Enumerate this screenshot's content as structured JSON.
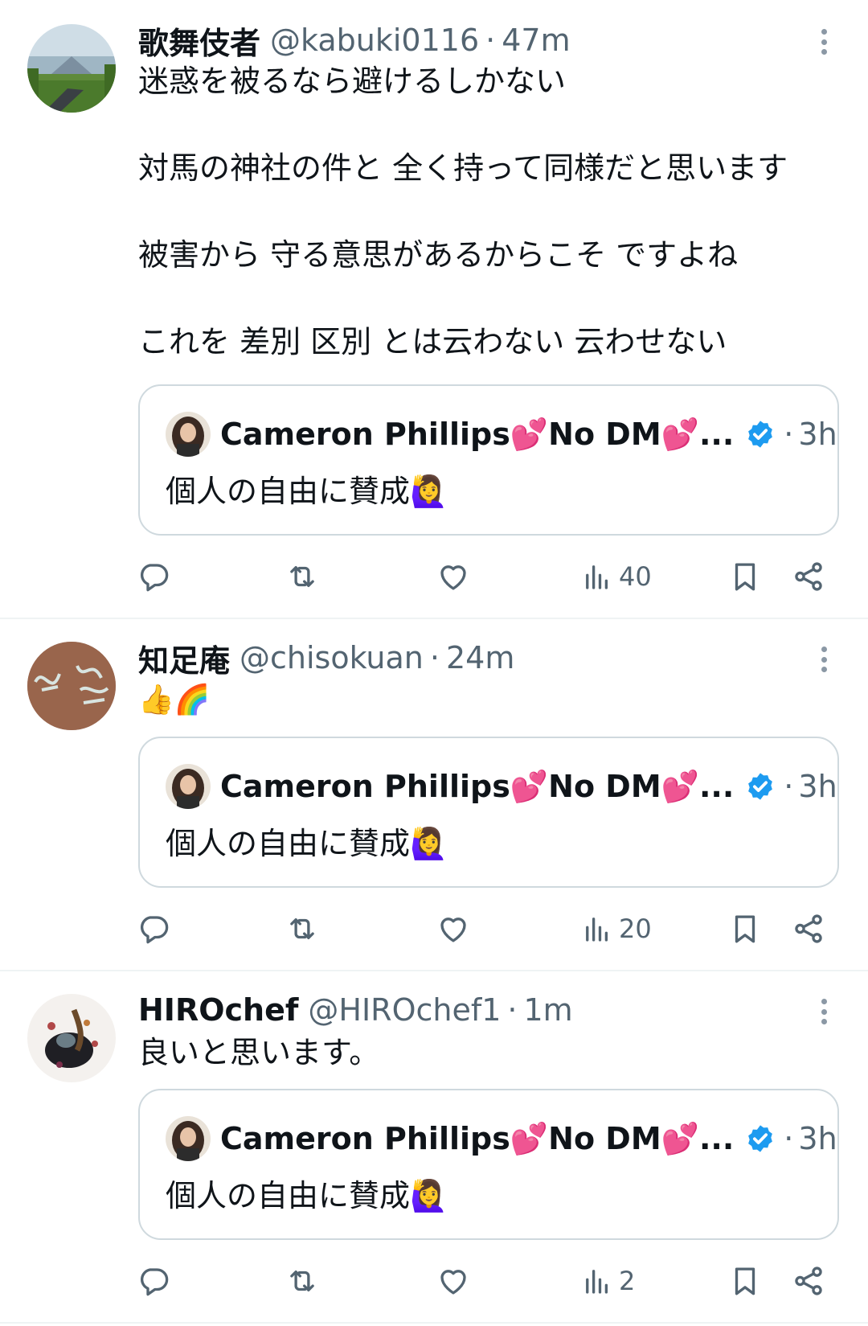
{
  "colors": {
    "text": "#0f1419",
    "secondary": "#536471",
    "border": "#cfd9de",
    "divider": "#eff3f4",
    "verified": "#1d9bf0"
  },
  "tweets": [
    {
      "name": "歌舞伎者",
      "handle": "@kabuki0116",
      "separator": "·",
      "time": "47m",
      "lines": [
        "迷惑を被るなら避けるしかない",
        "",
        "対馬の神社の件と 全く持って同様だと思います",
        "",
        "被害から 守る意思があるからこそ ですよね",
        "",
        "これを 差別 区別 とは云わない 云わせない"
      ],
      "quote": {
        "name": "Cameron Phillips💕No DM💕...",
        "separator": "·",
        "time": "3h",
        "text": "個人の自由に賛成🙋‍♀️"
      },
      "views": "40"
    },
    {
      "name": "知足庵",
      "handle": "@chisokuan",
      "separator": "·",
      "time": "24m",
      "lines": [
        "👍🌈"
      ],
      "quote": {
        "name": "Cameron Phillips💕No DM💕...",
        "separator": "·",
        "time": "3h",
        "text": "個人の自由に賛成🙋‍♀️"
      },
      "views": "20"
    },
    {
      "name": "HIROchef",
      "handle": "@HIROchef1",
      "separator": "·",
      "time": "1m",
      "lines": [
        "良いと思います。"
      ],
      "quote": {
        "name": "Cameron Phillips💕No DM💕...",
        "separator": "·",
        "time": "3h",
        "text": "個人の自由に賛成🙋‍♀️"
      },
      "views": "2"
    }
  ],
  "icons": {
    "reply": "reply-icon",
    "retweet": "retweet-icon",
    "like": "heart-icon",
    "views": "views-icon",
    "bookmark": "bookmark-icon",
    "share": "share-icon",
    "more": "more-icon",
    "verified": "verified-icon"
  }
}
